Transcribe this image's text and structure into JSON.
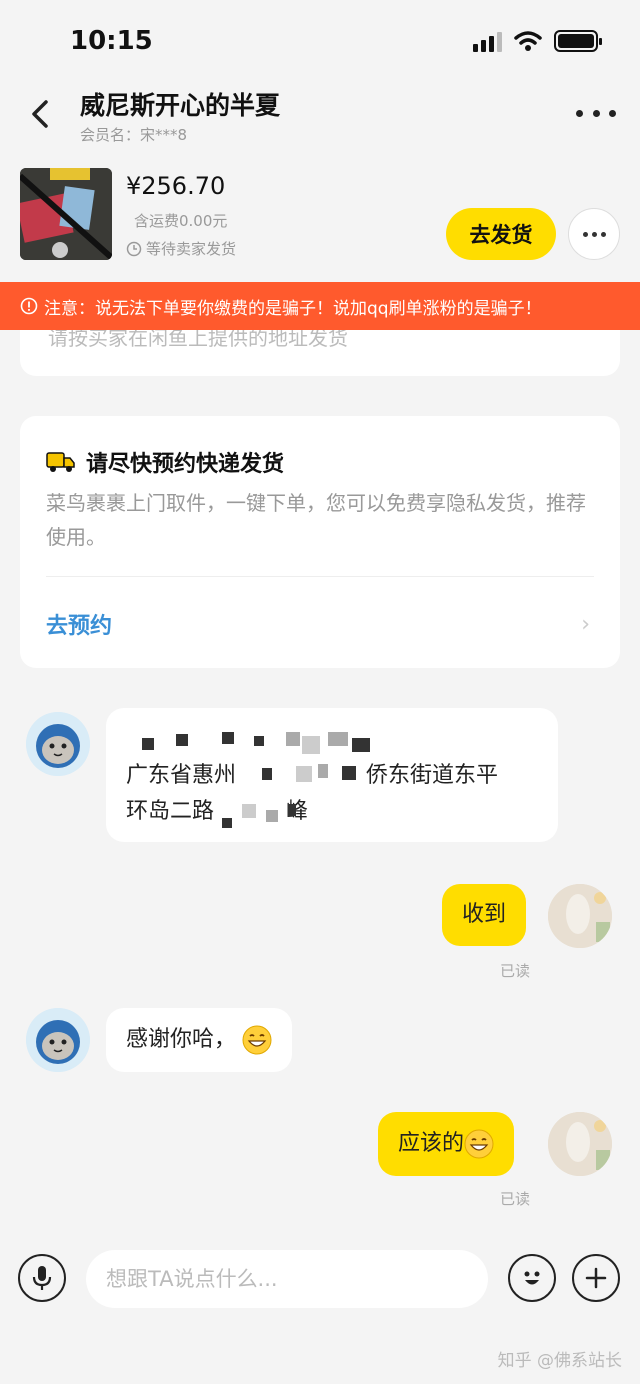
{
  "status_bar": {
    "time": "10:15"
  },
  "header": {
    "title": "威尼斯开心的半夏",
    "member_label": "会员名：宋***8"
  },
  "order": {
    "price": "¥256.70",
    "shipping": "含运费0.00元",
    "status": "等待卖家发货",
    "ship_button": "去发货"
  },
  "warning": {
    "text": "注意：说无法下单要你缴费的是骗子！说加qq刷单涨粉的是骗子！"
  },
  "prev_card": {
    "partial_text": "请按买家在闲鱼上提供的地址发货"
  },
  "pickup_card": {
    "title": "请尽快预约快递发货",
    "description": "菜鸟裹裹上门取件，一键下单，您可以免费享隐私发货，推荐使用。",
    "link": "去预约"
  },
  "messages": [
    {
      "side": "left",
      "line1": "广东省惠州",
      "line1_end": "侨东街道东平",
      "line2": "环岛二路",
      "line2_end": "峰"
    },
    {
      "side": "right",
      "text": "收到",
      "read": "已读"
    },
    {
      "side": "left",
      "text": "感谢你哈，"
    },
    {
      "side": "right",
      "text": "应该的",
      "read": "已读"
    }
  ],
  "input": {
    "placeholder": "想跟TA说点什么..."
  },
  "watermark": "知乎 @佛系站长",
  "colors": {
    "accent": "#ffdd00",
    "warning": "#ff5a2d",
    "link": "#3a8fd6"
  }
}
